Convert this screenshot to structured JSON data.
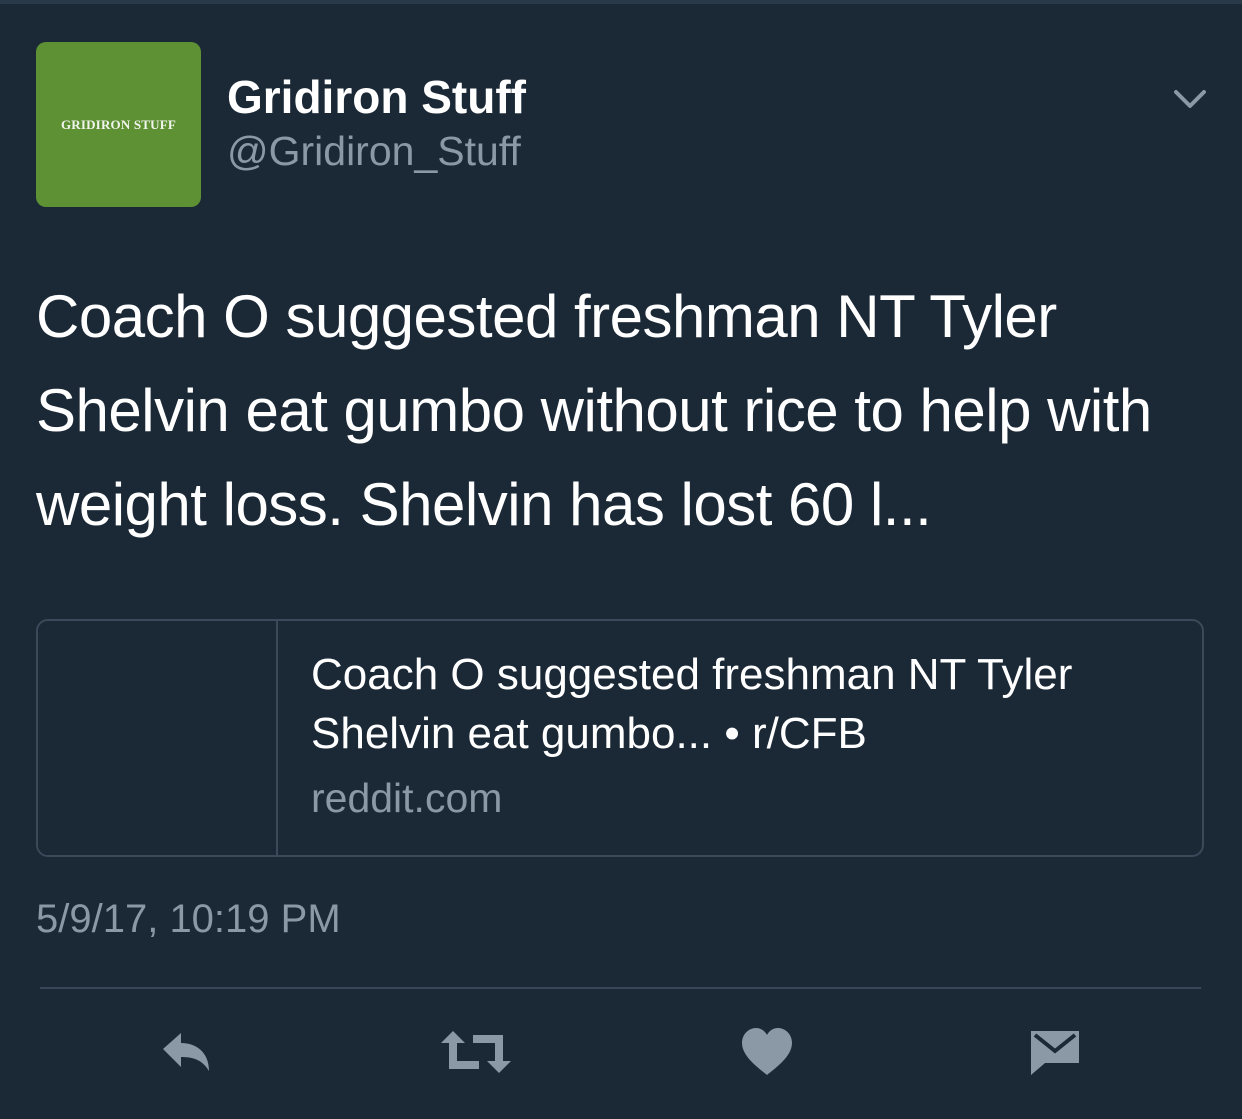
{
  "account": {
    "avatar_text": "GRIDIRON STUFF",
    "display_name": "Gridiron Stuff",
    "handle": "@Gridiron_Stuff"
  },
  "tweet": {
    "text": "Coach O suggested freshman NT Tyler Shelvin eat gumbo without rice to help with weight loss. Shelvin has lost 60 l...",
    "timestamp": "5/9/17, 10:19 PM"
  },
  "link_card": {
    "title": "Coach O suggested freshman NT Tyler Shelvin eat gumbo... • r/CFB",
    "domain": "reddit.com"
  },
  "actions": [
    {
      "name": "reply",
      "icon": "reply-icon"
    },
    {
      "name": "retweet",
      "icon": "retweet-icon"
    },
    {
      "name": "like",
      "icon": "heart-icon"
    },
    {
      "name": "direct-message",
      "icon": "envelope-icon"
    }
  ],
  "colors": {
    "background": "#1b2836",
    "avatar_bg": "#5e9134",
    "secondary_text": "#8b98a6",
    "icon_gray": "#8b98a6",
    "border": "#3b4a5a"
  }
}
